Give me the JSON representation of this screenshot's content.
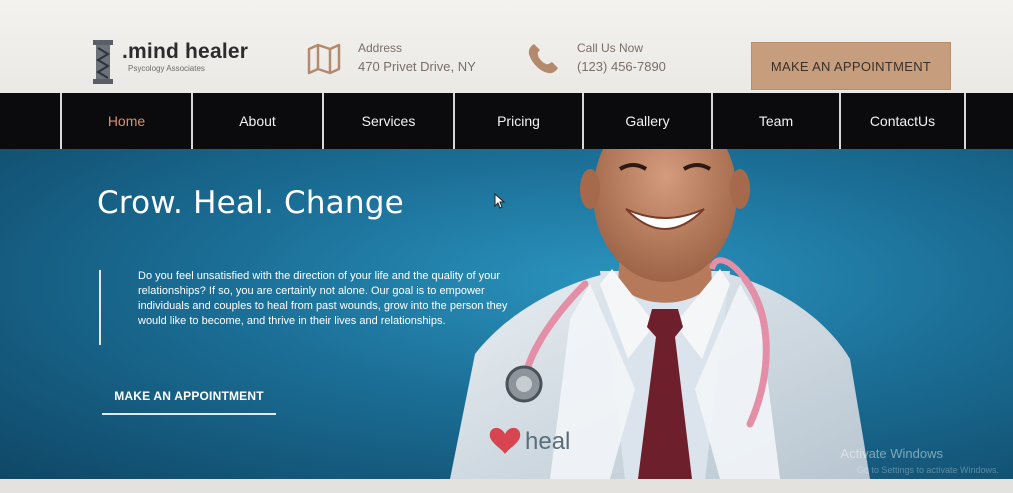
{
  "brand": {
    "name": ".mind healer",
    "tagline": "Psycology Associates"
  },
  "header": {
    "address_label": "Address",
    "address_value": "470 Privet Drive, NY",
    "call_label": "Call Us Now",
    "call_value": "(123) 456-7890",
    "appointment_button": "MAKE AN APPOINTMENT",
    "address_icon": "map-icon",
    "phone_icon": "phone-icon"
  },
  "nav": {
    "items": [
      {
        "label": "Home",
        "active": true
      },
      {
        "label": "About",
        "active": false
      },
      {
        "label": "Services",
        "active": false
      },
      {
        "label": "Pricing",
        "active": false
      },
      {
        "label": "Gallery",
        "active": false
      },
      {
        "label": "Team",
        "active": false
      },
      {
        "label": "ContactUs",
        "active": false
      }
    ]
  },
  "hero": {
    "title": "Crow. Heal. Change",
    "body": "Do you feel unsatisfied with the direction of your life and the quality of your relationships? If so, you are certainly not alone. Our goal is to empower individuals and couples to heal from past wounds, grow into the person they would like to become, and thrive in their lives and relationships.",
    "cta": "MAKE AN APPOINTMENT",
    "coat_logo_text": "heal"
  },
  "overlay": {
    "watermark": "Activate Windows",
    "watermark_sub": "Go to Settings to activate Windows."
  },
  "colors": {
    "accent": "#c79e7d",
    "nav_bg": "#0b0b0d",
    "nav_active": "#d6926a",
    "hero_blue": "#1b6e96",
    "text_muted": "#7a6e68"
  }
}
